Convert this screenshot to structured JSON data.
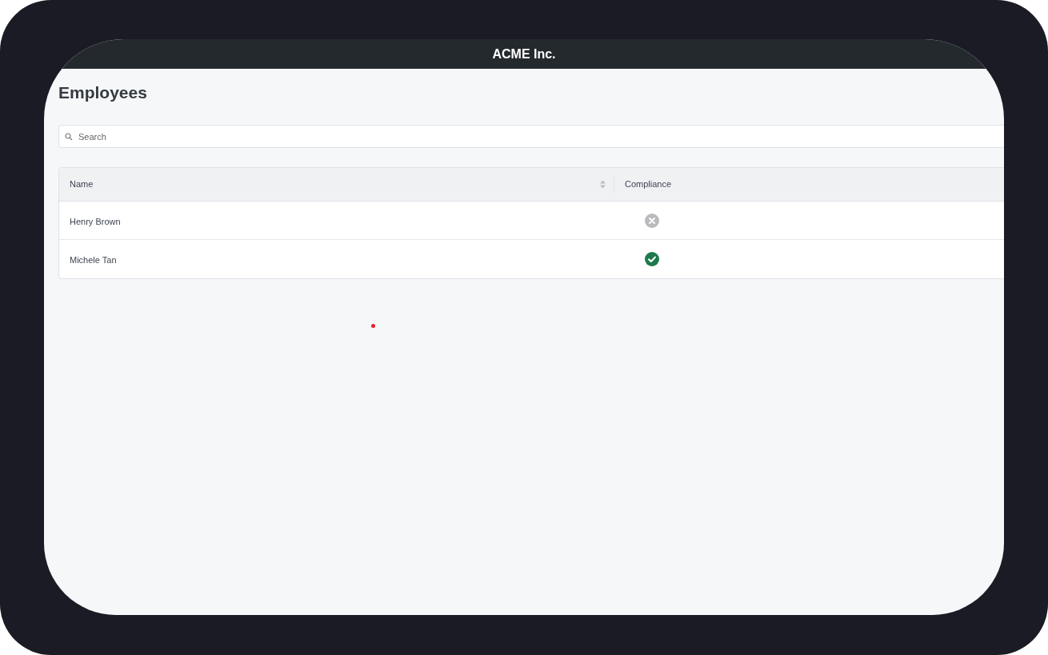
{
  "app_bar": {
    "title": "ACME Inc."
  },
  "page": {
    "title": "Employees"
  },
  "search": {
    "placeholder": "Search"
  },
  "table": {
    "columns": [
      {
        "label": "Name",
        "sortable": true
      },
      {
        "label": "Compliance",
        "sortable": false
      }
    ],
    "rows": [
      {
        "name": "Henry Brown",
        "compliant": false
      },
      {
        "name": "Michele Tan",
        "compliant": true
      }
    ]
  },
  "pointer": {
    "visible": true
  }
}
